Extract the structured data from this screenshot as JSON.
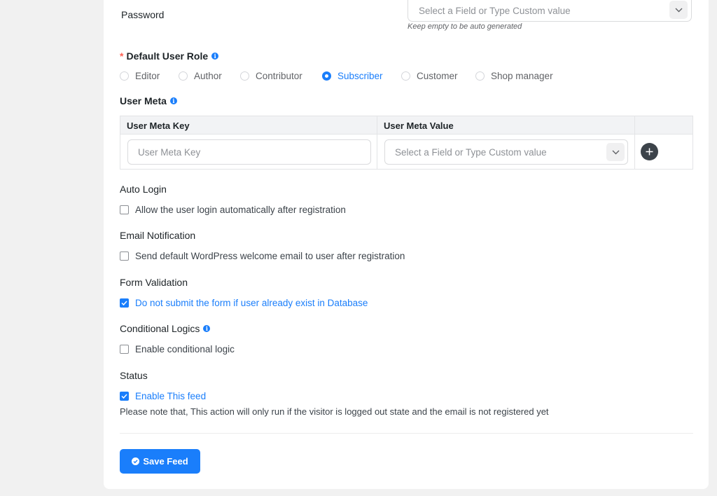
{
  "password": {
    "label": "Password",
    "placeholder": "Select a Field or Type Custom value",
    "hint": "Keep empty to be auto generated"
  },
  "user_role": {
    "required_mark": "*",
    "label": "Default User Role",
    "info_icon": "info-icon",
    "options": [
      "Editor",
      "Author",
      "Contributor",
      "Subscriber",
      "Customer",
      "Shop manager"
    ],
    "selected": "Subscriber"
  },
  "user_meta": {
    "label": "User Meta",
    "info_icon": "info-icon",
    "columns": [
      "User Meta Key",
      "User Meta Value"
    ],
    "key_placeholder": "User Meta Key",
    "value_placeholder": "Select a Field or Type Custom value",
    "add_icon": "plus-circle-icon"
  },
  "auto_login": {
    "title": "Auto Login",
    "checkbox_label": "Allow the user login automatically after registration",
    "checked": false
  },
  "email_notification": {
    "title": "Email Notification",
    "checkbox_label": "Send default WordPress welcome email to user after registration",
    "checked": false
  },
  "form_validation": {
    "title": "Form Validation",
    "checkbox_label": "Do not submit the form if user already exist in Database",
    "checked": true
  },
  "conditional_logics": {
    "title": "Conditional Logics",
    "info_icon": "info-icon",
    "checkbox_label": "Enable conditional logic",
    "checked": false
  },
  "status": {
    "title": "Status",
    "checkbox_label": "Enable This feed",
    "checked": true,
    "note": "Please note that, This action will only run if the visitor is logged out state and the email is not registered yet"
  },
  "save_button": {
    "label": "Save Feed",
    "icon": "check-circle-icon"
  },
  "colors": {
    "accent": "#1a7efb",
    "background": "#f1f1f1",
    "card": "#ffffff"
  }
}
